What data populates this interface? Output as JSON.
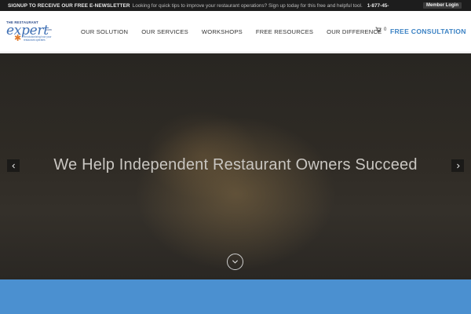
{
  "topbar": {
    "signup_text": "SIGNUP TO RECEIVE OUR FREE E-NEWSLETTER",
    "message": "Looking for quick tips to improve your restaurant operations? Sign up today for this free and helpful tool.",
    "phone": "1-877-45-",
    "member_login": "Member Login"
  },
  "logo": {
    "top_text": "THE RESTAURANT",
    "main_text": "expert",
    "domain": ".com",
    "tagline": "Revolutionizing how your restaurant operates"
  },
  "nav": {
    "items": [
      "OUR SOLUTION",
      "OUR SERVICES",
      "WORKSHOPS",
      "FREE RESOURCES",
      "OUR DIFFERENCE"
    ]
  },
  "cart": {
    "count": "0"
  },
  "cta": {
    "label": "FREE CONSULTATION"
  },
  "hero": {
    "title": "We Help Independent Restaurant Owners Succeed"
  },
  "colors": {
    "topbar_bg": "#1d1d1d",
    "accent": "#3b82c4",
    "band": "#4b90d0",
    "hero_text": "#c9c6c1"
  },
  "icons": {
    "cart": "cart-icon",
    "prev": "chevron-left-icon",
    "next": "chevron-right-icon",
    "scroll": "chevron-down-icon"
  }
}
